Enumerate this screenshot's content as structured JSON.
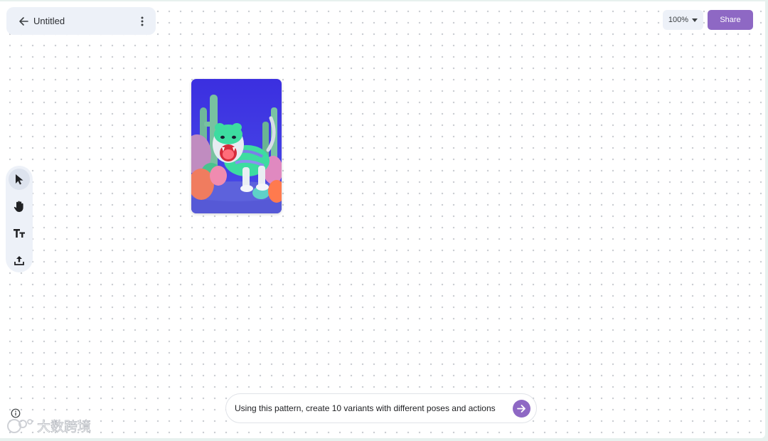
{
  "header": {
    "title": "Untitled",
    "back_icon": "arrow-left-icon",
    "menu_icon": "more-vertical-icon"
  },
  "zoom": {
    "level": "100%",
    "icon": "caret-down-icon"
  },
  "share": {
    "label": "Share"
  },
  "canvas_image": {
    "subject": "tiger"
  },
  "toolbar": {
    "tools": [
      {
        "name": "select",
        "icon": "cursor-icon",
        "active": true
      },
      {
        "name": "pan",
        "icon": "hand-icon",
        "active": false
      },
      {
        "name": "text",
        "icon": "text-icon",
        "active": false
      },
      {
        "name": "upload",
        "icon": "upload-icon",
        "active": false
      }
    ]
  },
  "prompt": {
    "value": "Using this pattern, create 10 variants with different poses and actions"
  },
  "watermark": {
    "text": "大数跨境"
  },
  "colors": {
    "accent": "#8e68c4",
    "panel": "#edf1f8",
    "canvas": "#ffffff"
  }
}
